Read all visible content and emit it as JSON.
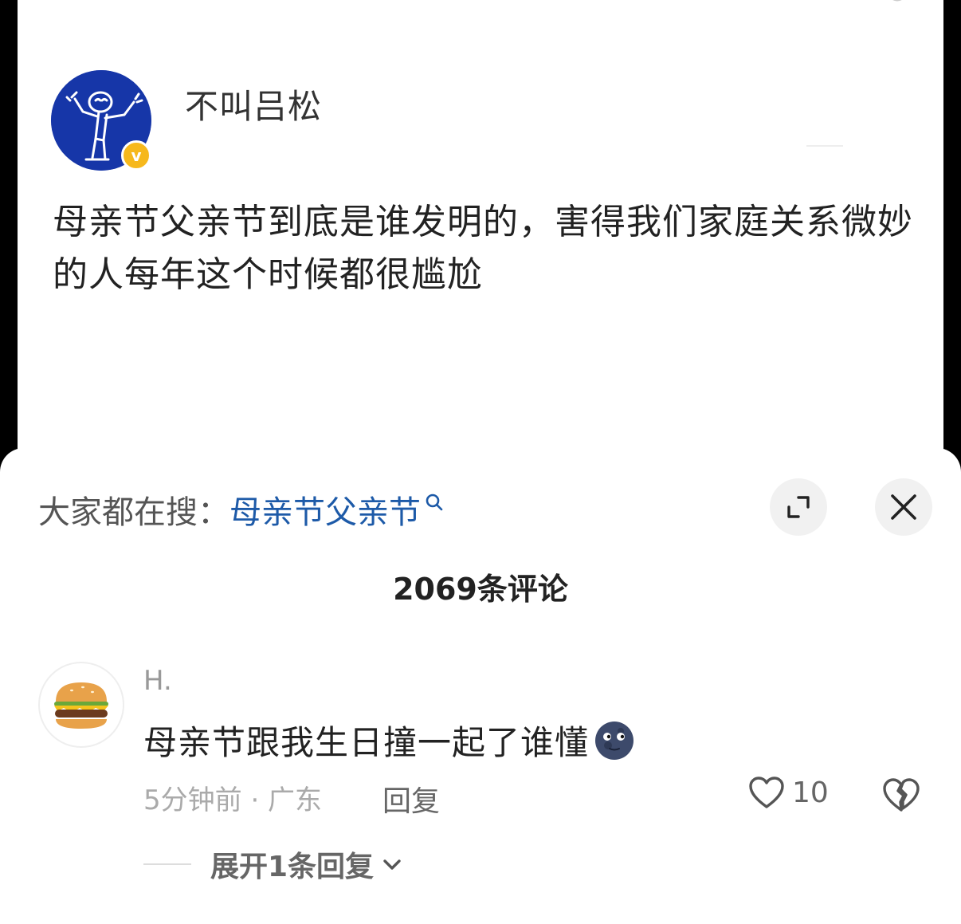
{
  "post": {
    "author_name": "不叫吕松",
    "badge": "v",
    "text": "母亲节父亲节到底是谁发明的，害得我们家庭关系微妙的人每年这个时候都很尴尬"
  },
  "sheet": {
    "search_prefix": "大家都在搜：",
    "search_term": "母亲节父亲节",
    "comment_count": "2069条评论"
  },
  "comment": {
    "user": "H.",
    "text": "母亲节跟我生日撞一起了谁懂",
    "meta": "5分钟前 · 广东",
    "reply_label": "回复",
    "likes": "10",
    "expand_label": "展开1条回复"
  },
  "colors": {
    "avatar_bg": "#1636a8",
    "badge": "#f6b81c",
    "link": "#1d5aa8"
  }
}
